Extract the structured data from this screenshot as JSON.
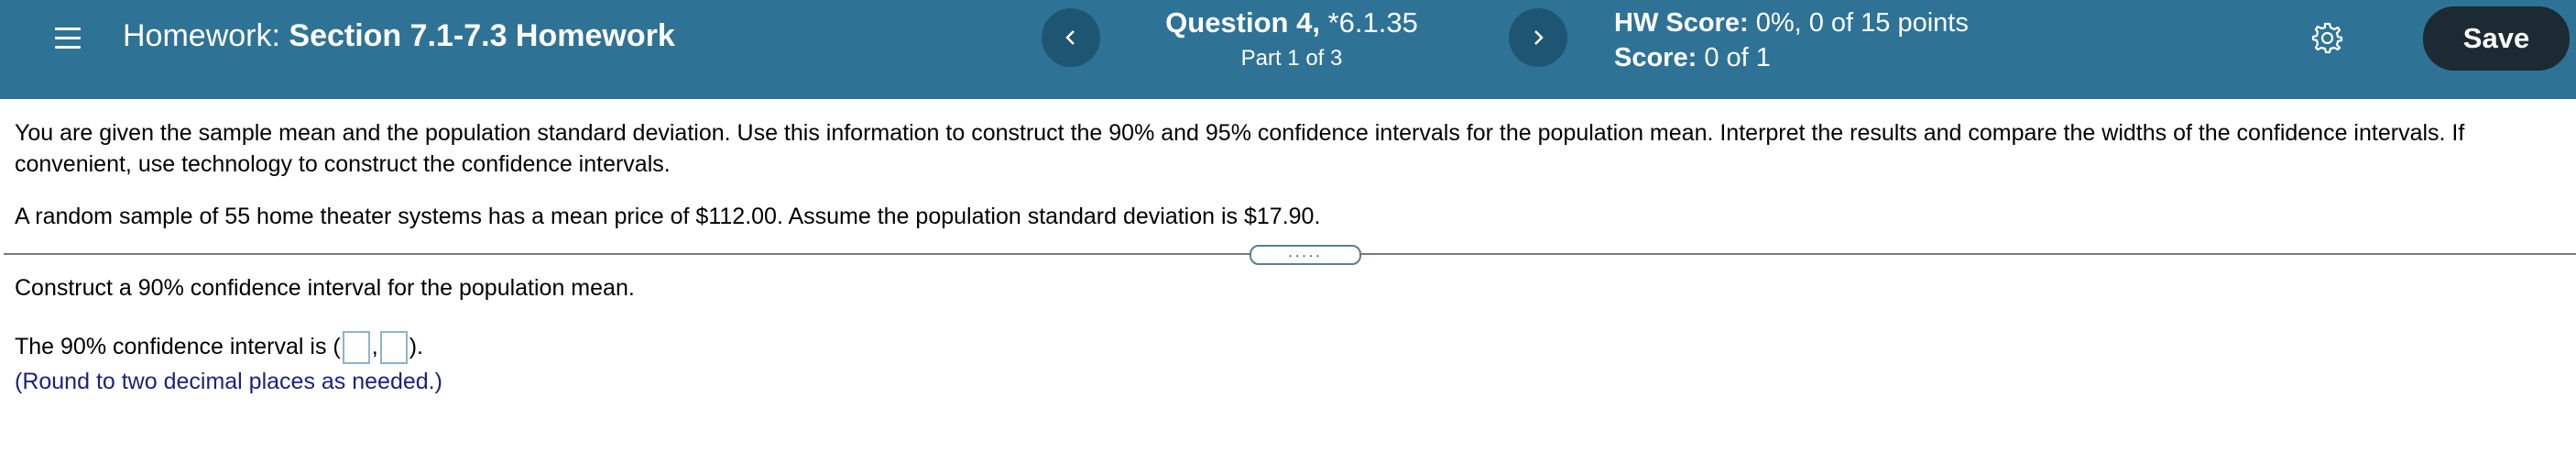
{
  "header": {
    "homework_prefix": "Homework:",
    "homework_name": "Section 7.1-7.3 Homework",
    "question_label": "Question 4,",
    "question_id": "*6.1.35",
    "question_part": "Part 1 of 3",
    "hw_score_label": "HW Score:",
    "hw_score_value": "0%, 0 of 15 points",
    "score_label": "Score:",
    "score_value": "0 of 1",
    "save_label": "Save",
    "nav_prev_icon": "chevron-left-icon",
    "nav_next_icon": "chevron-right-icon",
    "settings_icon": "gear-icon",
    "menu_icon": "hamburger-menu-icon",
    "colors": {
      "header_bg": "#2e7396",
      "nav_button_bg": "#1e5573",
      "save_button_bg": "#1c2a33",
      "note_text": "#1a237e"
    }
  },
  "question": {
    "instructions": "You are given the sample mean and the population standard deviation. Use this information to construct the 90% and 95% confidence intervals for the population mean. Interpret the results and compare the widths of the confidence intervals. If convenient, use technology to construct the confidence intervals.",
    "sample_text": "A random sample of 55 home theater systems has a mean price of $112.00. Assume the population standard deviation is $17.90.",
    "expand_handle_text": ".....",
    "prompt": "Construct a 90% confidence interval for the population mean.",
    "interval_prefix": "The 90% confidence interval is (",
    "interval_separator": ",",
    "interval_suffix": ").",
    "lower_bound_value": "",
    "upper_bound_value": "",
    "round_note": "(Round to two decimal places as needed.)"
  }
}
